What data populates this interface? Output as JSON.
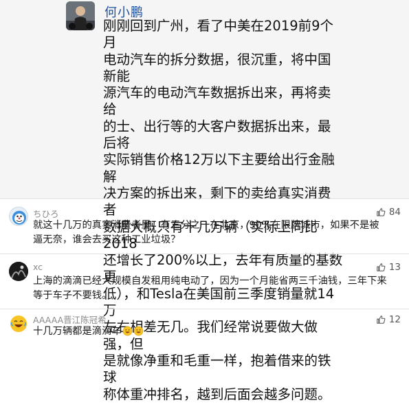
{
  "post": {
    "author": "何小鹏",
    "body": "刚刚回到广州，看了中美在2019前9个月\n电动汽车的拆分数据，很沉重，将中国新能\n源汽车的电动汽车数据拆出来，再将卖给\n的士、出行等的大客户数据拆出来，最后将\n实际销售价格12万以下主要给出行金融解\n决方案的拆出来，剩下的卖给真实消费者\n数据大概只有十几万辆（实际上同比2018\n还增长了200%以上，去年有质量的基数更\n低），和Tesla在美国前三季度销量就14万\n左右相差无几。我们经常说要做大做强，但\n是就像净重和毛重一样，抱着借来的铁球\n称体重冲排名，越到后面会越多问题。"
  },
  "comments": [
    {
      "name": "ちひろ",
      "text": "就这十几万的真实消费者里，有三分之一在北京，90%在限牌城市，如果不是被逼无奈，谁会去买这种工业垃圾？",
      "likes": "84",
      "avatar_icon": "robot-avatar-icon"
    },
    {
      "name": "xc",
      "text": "上海的滴滴已经大规模自发租用纯电动了，因为一个月能省两三千油钱，三年下来等于车子不要钱。",
      "likes": "13",
      "avatar_icon": "dark-photo-avatar-icon"
    },
    {
      "name": "AAAAA晋江陈冠希",
      "text": "十几万辆都是滴滴车",
      "likes": "12",
      "avatar_icon": "laughing-face-avatar-icon",
      "trailing_emoji": "grinning-face-emoji-icon"
    }
  ],
  "colors": {
    "author_blue": "#1d4f9e",
    "post_bg": "#f5f5f5",
    "meta_gray": "#8a8a8a",
    "emoji_yellow": "#f7c325"
  }
}
